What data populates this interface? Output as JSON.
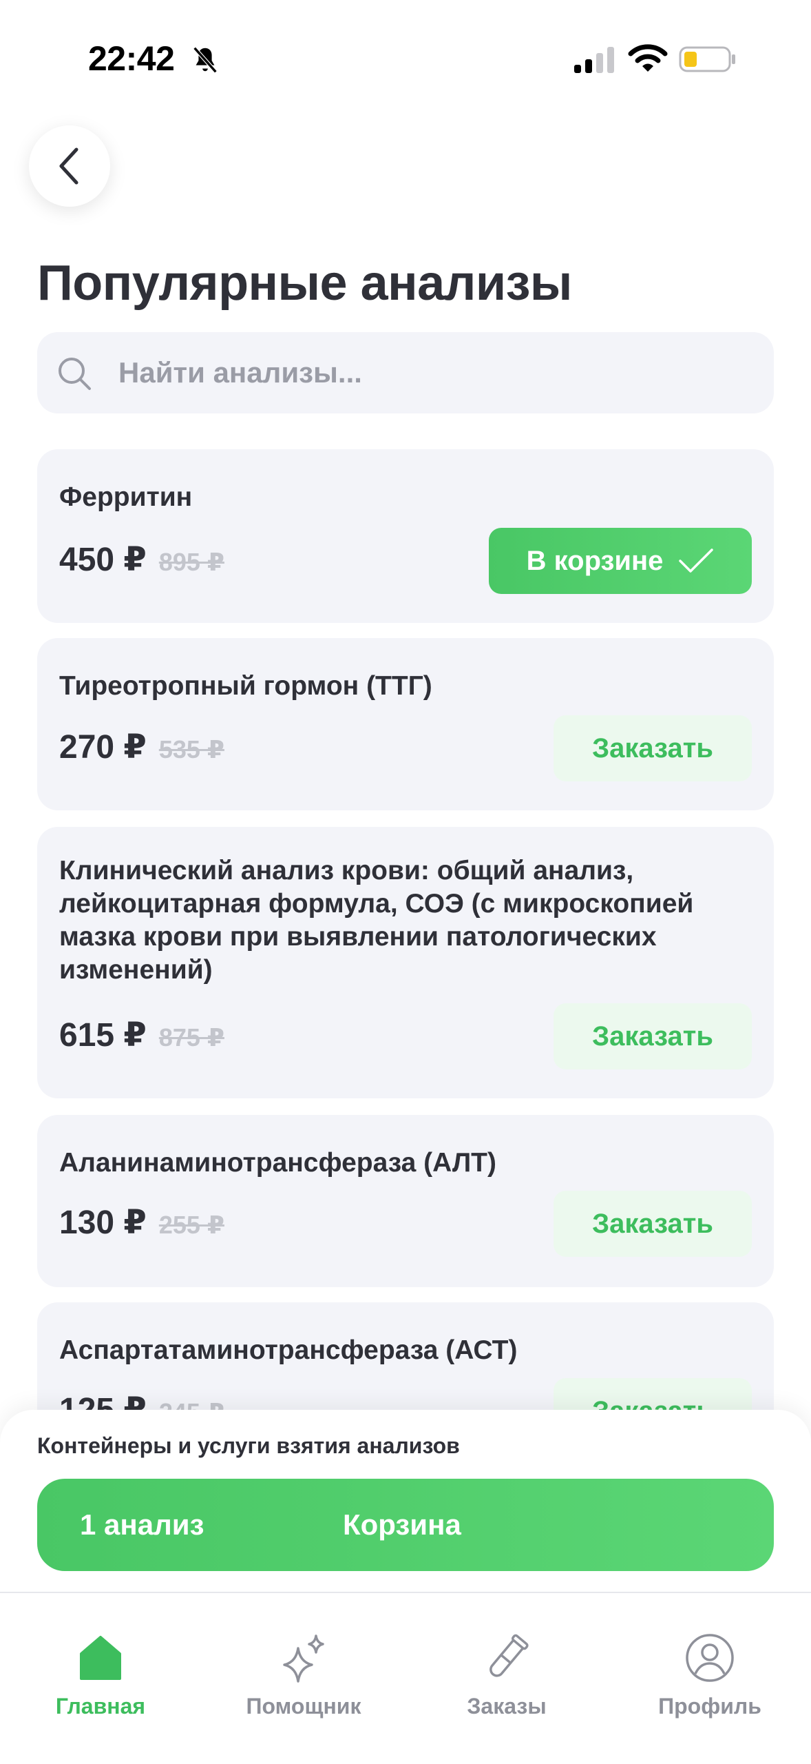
{
  "status_bar": {
    "time": "22:42"
  },
  "header": {
    "title": "Популярные анализы"
  },
  "search": {
    "placeholder": "Найти анализы..."
  },
  "tests": [
    {
      "name": "Ферритин",
      "price": "450 ₽",
      "old_price": "895 ₽",
      "action": "В корзине",
      "in_cart": true
    },
    {
      "name": "Тиреотропный гормон (ТТГ)",
      "price": "270 ₽",
      "old_price": "535 ₽",
      "action": "Заказать",
      "in_cart": false
    },
    {
      "name": "Клинический анализ крови: общий анализ, лейкоцитарная формула, СОЭ (с микроскопией мазка крови при выявлении патологических изменений)",
      "price": "615 ₽",
      "old_price": "875 ₽",
      "action": "Заказать",
      "in_cart": false
    },
    {
      "name": "Аланинаминотрансфераза (АЛТ)",
      "price": "130 ₽",
      "old_price": "255 ₽",
      "action": "Заказать",
      "in_cart": false
    },
    {
      "name": "Аспартатаминотрансфераза (АСТ)",
      "price": "125 ₽",
      "old_price": "245 ₽",
      "action": "Заказать",
      "in_cart": false
    }
  ],
  "cart_sheet": {
    "note": "Контейнеры и услуги взятия анализов",
    "count_label": "1 анализ",
    "cart_label": "Корзина"
  },
  "tab_bar": {
    "items": [
      {
        "label": "Главная",
        "icon": "home-icon",
        "active": true
      },
      {
        "label": "Помощник",
        "icon": "sparkles-icon",
        "active": false
      },
      {
        "label": "Заказы",
        "icon": "test-tube-icon",
        "active": false
      },
      {
        "label": "Профиль",
        "icon": "profile-icon",
        "active": false
      }
    ]
  },
  "colors": {
    "accent": "#3dbd5d",
    "card_bg": "#f3f4f9",
    "text": "#2f3038",
    "muted": "#8e9099"
  }
}
